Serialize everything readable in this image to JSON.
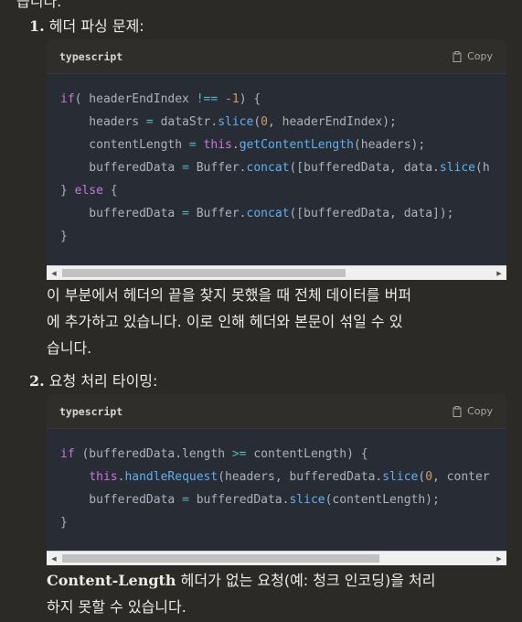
{
  "top_fragment": "습니다.",
  "items": [
    {
      "number": "1.",
      "heading": "헤더 파싱 문제:",
      "code": {
        "language": "typescript",
        "copy_label": "Copy",
        "copy_icon": "clipboard-icon",
        "lines": [
          [
            [
              "kw",
              "if"
            ],
            [
              "",
              "( headerEndIndex "
            ],
            [
              "op",
              "!=="
            ],
            [
              "",
              " "
            ],
            [
              "num",
              "-1"
            ],
            [
              "",
              ") {"
            ]
          ],
          [
            [
              "",
              "    headers "
            ],
            [
              "op",
              "="
            ],
            [
              "",
              " dataStr."
            ],
            [
              "fn",
              "slice"
            ],
            [
              "",
              "("
            ],
            [
              "num",
              "0"
            ],
            [
              "",
              ", headerEndIndex);"
            ]
          ],
          [
            [
              "",
              "    contentLength "
            ],
            [
              "op",
              "="
            ],
            [
              "",
              " "
            ],
            [
              "this",
              "this"
            ],
            [
              "",
              "."
            ],
            [
              "fn",
              "getContentLength"
            ],
            [
              "",
              "(headers);"
            ]
          ],
          [
            [
              "",
              "    bufferedData "
            ],
            [
              "op",
              "="
            ],
            [
              "",
              " Buffer."
            ],
            [
              "fn",
              "concat"
            ],
            [
              "",
              "([bufferedData, data."
            ],
            [
              "fn",
              "slice"
            ],
            [
              "",
              "(h"
            ]
          ],
          [
            [
              "",
              "} "
            ],
            [
              "kw",
              "else"
            ],
            [
              "",
              " {"
            ]
          ],
          [
            [
              "",
              "    bufferedData "
            ],
            [
              "op",
              "="
            ],
            [
              "",
              " Buffer."
            ],
            [
              "fn",
              "concat"
            ],
            [
              "",
              "([bufferedData, data]);"
            ]
          ],
          [
            [
              "",
              "}"
            ]
          ]
        ],
        "scroll_thumb_fraction": 0.66
      },
      "paragraph": [
        "이 부분에서 헤더의 끝을 찾지 못했을 때 전체 데이터를 버퍼",
        "에 추가하고 있습니다. 이로 인해 헤더와 본문이 섞일 수 있",
        "습니다."
      ]
    },
    {
      "number": "2.",
      "heading": "요청 처리 타이밍:",
      "code": {
        "language": "typescript",
        "copy_label": "Copy",
        "copy_icon": "clipboard-icon",
        "lines": [
          [
            [
              "kw",
              "if"
            ],
            [
              "",
              " (bufferedData.length "
            ],
            [
              "op",
              ">="
            ],
            [
              "",
              " contentLength) {"
            ]
          ],
          [
            [
              "",
              "    "
            ],
            [
              "this",
              "this"
            ],
            [
              "",
              "."
            ],
            [
              "fn",
              "handleRequest"
            ],
            [
              "",
              "(headers, bufferedData."
            ],
            [
              "fn",
              "slice"
            ],
            [
              "",
              "("
            ],
            [
              "num",
              "0"
            ],
            [
              "",
              ", conter"
            ]
          ],
          [
            [
              "",
              "    bufferedData "
            ],
            [
              "op",
              "="
            ],
            [
              "",
              " bufferedData."
            ],
            [
              "fn",
              "slice"
            ],
            [
              "",
              "(contentLength);"
            ]
          ],
          [
            [
              "",
              "}"
            ]
          ]
        ],
        "scroll_thumb_fraction": 0.74
      },
      "paragraph_bold": "Content-Length",
      "paragraph": [
        " 헤더가 없는 요청(예: 청크 인코딩)을 처리",
        "하지 못할 수 있습니다."
      ]
    }
  ]
}
